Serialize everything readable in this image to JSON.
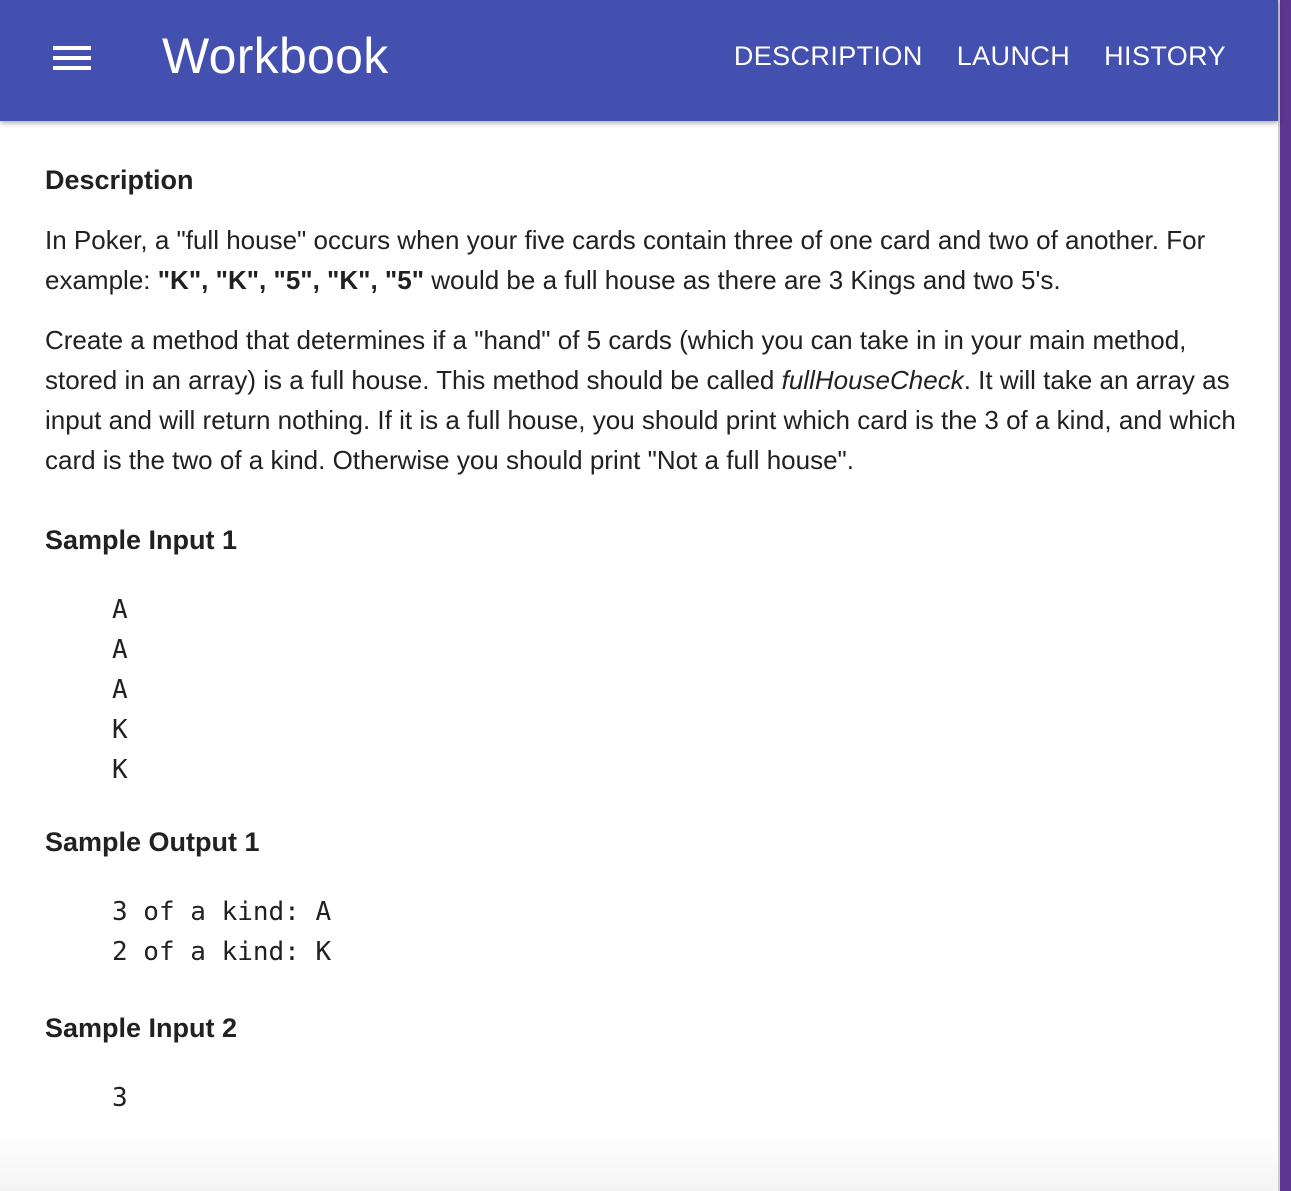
{
  "app": {
    "title": "Workbook",
    "accent_color": "#4350af",
    "menu_icon": "menu-icon"
  },
  "nav": {
    "items": [
      {
        "label": "DESCRIPTION"
      },
      {
        "label": "LAUNCH"
      },
      {
        "label": "HISTORY"
      }
    ]
  },
  "content": {
    "heading": "Description",
    "para1": {
      "before": "In Poker, a \"full house\" occurs when your five cards contain three of one card and two of another. For example: ",
      "bold": "\"K\", \"K\", \"5\", \"K\", \"5\"",
      "after": " would be a full house as there are 3 Kings and two 5's."
    },
    "para2": {
      "before": "Create a method that determines if a \"hand\" of 5 cards (which you can take in in your main method, stored in an array) is a full house. This method should be called ",
      "italic": "fullHouseCheck",
      "after": ". It will take an array as input and will return nothing. If it is a full house, you should print which card is the 3 of a kind, and which card is the two of a kind. Otherwise you should print \"Not a full house\"."
    },
    "sample_input_1": {
      "heading": "Sample Input 1",
      "code": "A\nA\nA\nK\nK"
    },
    "sample_output_1": {
      "heading": "Sample Output 1",
      "code": "3 of a kind: A\n2 of a kind: K"
    },
    "sample_input_2": {
      "heading": "Sample Input 2",
      "code": "3"
    }
  }
}
